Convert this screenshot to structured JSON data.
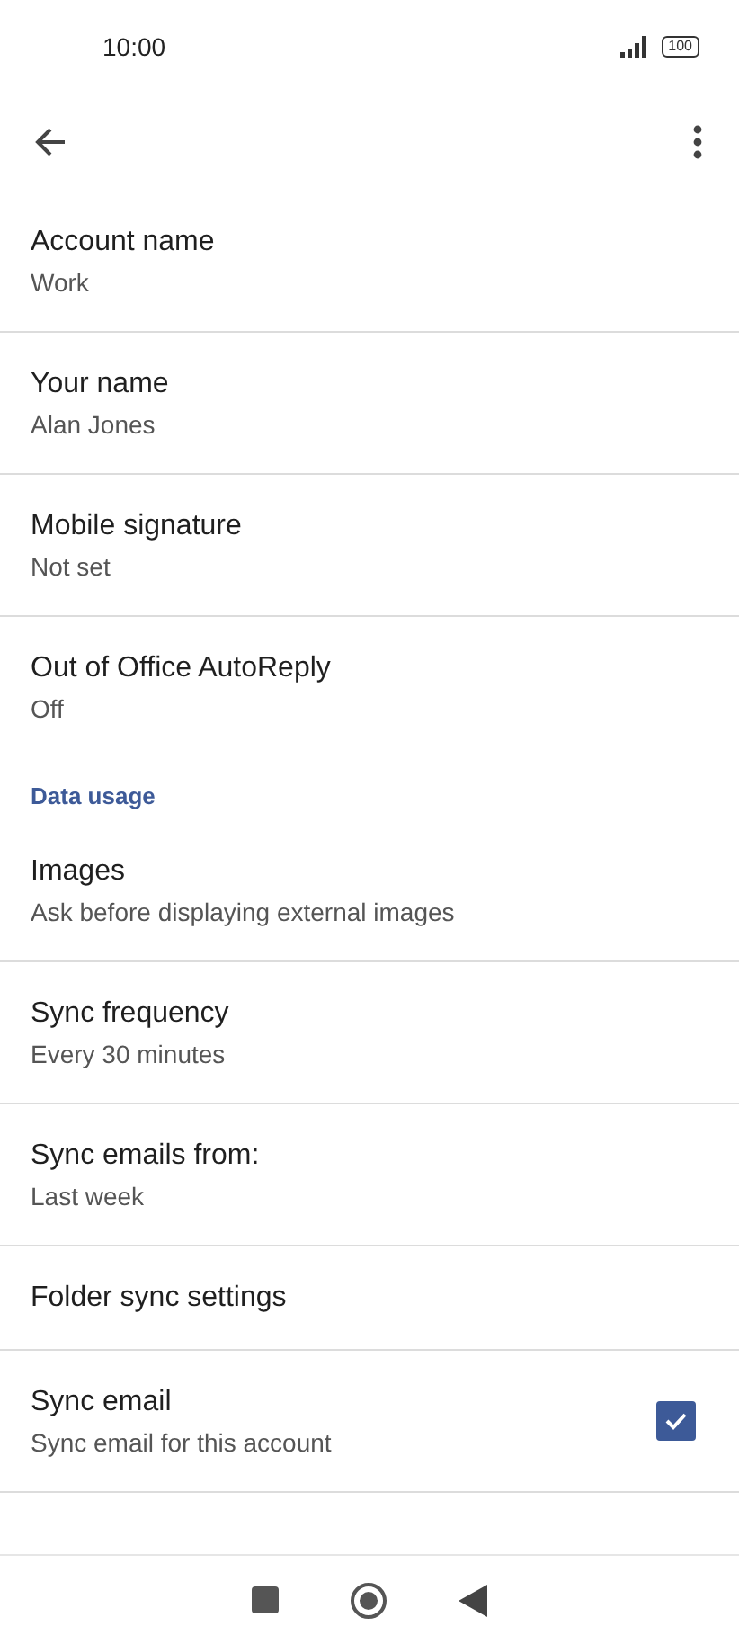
{
  "status_bar": {
    "time": "10:00",
    "battery": "100"
  },
  "items": [
    {
      "kind": "setting",
      "title": "Account name",
      "subtitle": "Work"
    },
    {
      "kind": "setting",
      "title": "Your name",
      "subtitle": "Alan Jones"
    },
    {
      "kind": "setting",
      "title": "Mobile signature",
      "subtitle": "Not set"
    },
    {
      "kind": "setting",
      "title": "Out of Office AutoReply",
      "subtitle": "Off"
    },
    {
      "kind": "header",
      "title": "Data usage"
    },
    {
      "kind": "setting",
      "title": "Images",
      "subtitle": "Ask before displaying external images"
    },
    {
      "kind": "setting",
      "title": "Sync frequency",
      "subtitle": "Every 30 minutes"
    },
    {
      "kind": "setting",
      "title": "Sync emails from:",
      "subtitle": "Last week"
    },
    {
      "kind": "setting",
      "title": "Folder sync settings"
    },
    {
      "kind": "checkbox",
      "title": "Sync email",
      "subtitle": "Sync email for this account",
      "checked": true
    }
  ]
}
